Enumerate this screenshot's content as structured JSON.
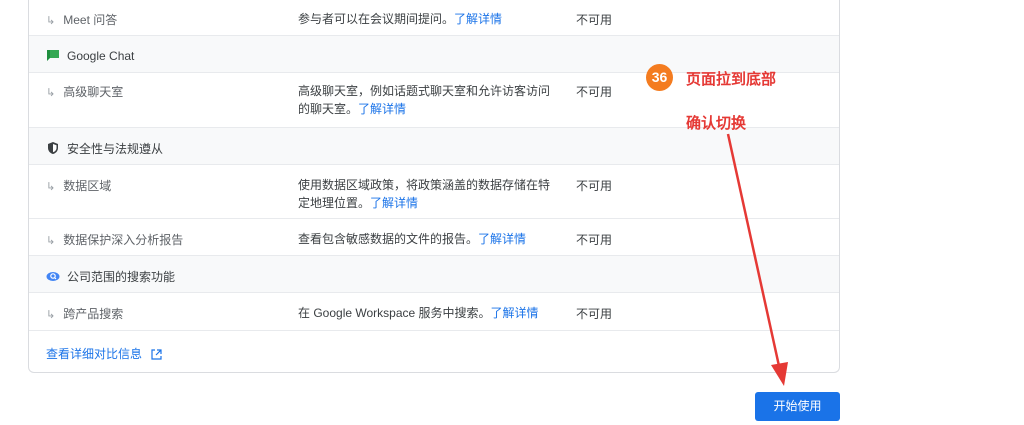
{
  "rows": [
    {
      "type": "child",
      "name": "Meet 问答",
      "desc_text": "参与者可以在会议期间提问。",
      "link": "了解详情",
      "availability": "不可用"
    },
    {
      "type": "section",
      "name": "Google Chat",
      "icon": "google-chat-icon"
    },
    {
      "type": "child",
      "name": "高级聊天室",
      "desc_text": "高级聊天室，例如话题式聊天室和允许访客访问的聊天室。",
      "link": "了解详情",
      "availability": "不可用"
    },
    {
      "type": "section",
      "name": "安全性与法规遵从",
      "icon": "shield-icon"
    },
    {
      "type": "child",
      "name": "数据区域",
      "desc_text": "使用数据区域政策，将政策涵盖的数据存储在特定地理位置。",
      "link": "了解详情",
      "availability": "不可用"
    },
    {
      "type": "child",
      "name": "数据保护深入分析报告",
      "desc_text": "查看包含敏感数据的文件的报告。",
      "link": "了解详情",
      "availability": "不可用"
    },
    {
      "type": "section",
      "name": "公司范围的搜索功能",
      "icon": "cloud-search-icon"
    },
    {
      "type": "child",
      "name": "跨产品搜索",
      "desc_text": "在 Google Workspace 服务中搜索。",
      "link": "了解详情",
      "availability": "不可用"
    }
  ],
  "compare_link": "查看详细对比信息",
  "start_button": "开始使用",
  "annotation": {
    "number": "36",
    "line1": "页面拉到底部",
    "line2": "确认切换"
  },
  "colors": {
    "accent": "#1a73e8",
    "annotation_red": "#e53935",
    "annotation_orange": "#f47c20",
    "chat_green": "#1e8e3e"
  }
}
